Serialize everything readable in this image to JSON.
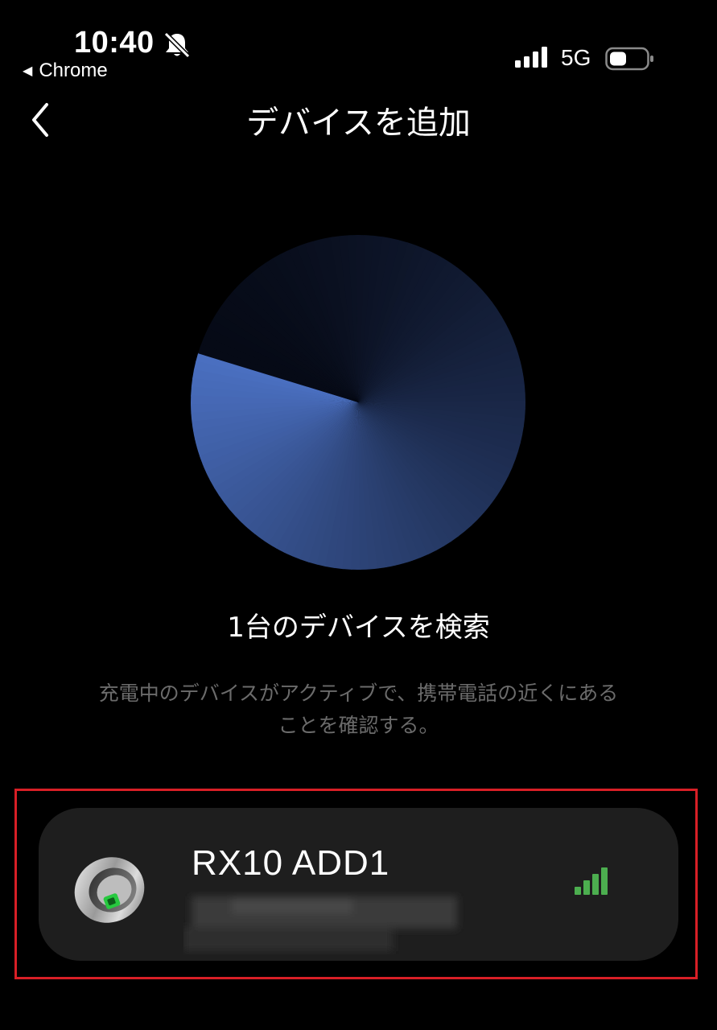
{
  "status_bar": {
    "time": "10:40",
    "back_app": "Chrome",
    "network": "5G",
    "icons": [
      "bell-mute-icon",
      "cellular-signal-icon",
      "battery-icon"
    ]
  },
  "nav": {
    "title": "デバイスを追加",
    "back_icon": "chevron-left-icon"
  },
  "scan": {
    "status": "1台のデバイスを検索",
    "hint_line1": "充電中のデバイスがアクティブで、携帯電話の近くにある",
    "hint_line2": "ことを確認する。"
  },
  "device": {
    "name": "RX10 ADD1",
    "image": "smart-ring",
    "signal_icon": "signal-strength-icon",
    "signal_level": 4,
    "signal_level_max": 4
  },
  "colors": {
    "background": "#000000",
    "radar_blue": "#4a6fc0",
    "card": "#1e1e1e",
    "signal_green": "#4cae4f",
    "highlight": "#d81f26"
  }
}
